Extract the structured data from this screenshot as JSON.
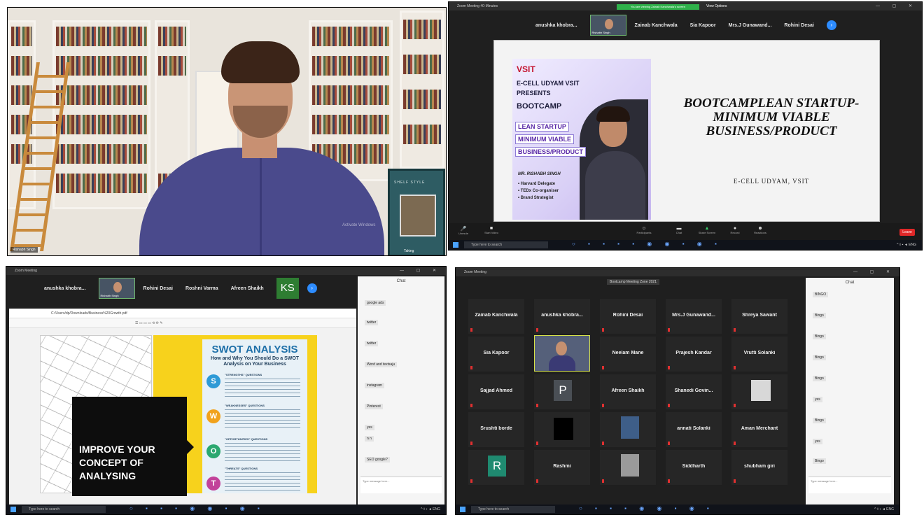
{
  "panel1": {
    "name_tag": "Rishabh Singh",
    "watermark": "Activate Windows",
    "poster_title": "SHELF STYLE",
    "poster_footer": "Taking"
  },
  "panel2": {
    "title": "Zoom Meeting 40-Minutes",
    "banner": "You are viewing Zainab Kanchwala's screen",
    "view_options": "View Options",
    "participants": [
      "anushka khobra...",
      "Zainab Kanchwala",
      "Sia Kapoor",
      "Mrs.J Gunawand...",
      "Rohini Desai"
    ],
    "thumb_label": "Rishabh Singh",
    "slide": {
      "logo": "VSIT",
      "lines": [
        "E-CELL UDYAM VSIT",
        "PRESENTS",
        "BOOTCAMP"
      ],
      "highlights": [
        "LEAN STARTUP",
        "MINIMUM VIABLE",
        "BUSINESS/PRODUCT"
      ],
      "speaker": "MR. RISHABH SINGH",
      "bullets": [
        "• Harvard Delegate",
        "• TEDx Co-organiser",
        "• Brand Strategist"
      ],
      "title": "BOOTCAMPLEAN STARTUP- MINIMUM VIABLE BUSINESS/PRODUCT",
      "subtitle": "E-CELL UDYAM, VSIT"
    },
    "controls": [
      "Unmute",
      "Start Video",
      "Participants",
      "Chat",
      "Share Screen",
      "Record",
      "Reactions"
    ],
    "end_label": "Leave",
    "taskbar_search": "Type here to search"
  },
  "panel3": {
    "title": "Zoom Meeting",
    "participants": [
      "anushka khobra...",
      "Rohini Desai",
      "Roshni Varma",
      "Afreen Shaikh"
    ],
    "thumb_label": "Rishabh Singh",
    "ks_avatar": "KS",
    "url": "C:/Users/dp/Downloads/Business%20Growth.pdf",
    "slide_text": "IMPROVE YOUR CONCEPT OF ANALYSING",
    "swot_title": "SWOT ANALYSIS",
    "swot_subtitle": "How and Why You Should Do a SWOT Analysis on Your Business",
    "swot_letters": [
      "S",
      "W",
      "O",
      "T"
    ],
    "swot_heads": [
      "\"STRENGTHS\" QUESTIONS",
      "\"WEAKNESSES\" QUESTIONS",
      "\"OPPORTUNITIES\" QUESTIONS",
      "\"THREATS\" QUESTIONS"
    ],
    "chat_title": "Chat",
    "chat_msgs": [
      "google ads",
      "twitter",
      "twitter",
      "Word and textsaju",
      "instagram",
      "Pinterest",
      "yes",
      "n n",
      "SEO google?"
    ],
    "chat_placeholder": "Type message here...",
    "taskbar_search": "Type here to search"
  },
  "panel4": {
    "title": "Zoom Meeting",
    "meeting_label": "Bootcamp Meeting Zone 2021",
    "tiles": [
      "Zainab Kanchwala",
      "anushka khobra...",
      "Rohini Desai",
      "Mrs.J Gunawand...",
      "Shreya Sawant",
      "Sia Kapoor",
      "",
      "Neelam Mane",
      "Prajesh Kandar",
      "Vrutti Solanki",
      "Sajjad Ahmed",
      "",
      "Afreen Shaikh",
      "Shanedi Govin...",
      "",
      "Srushti borde",
      "",
      "",
      "annati Solanki",
      "Aman Merchant",
      "",
      "Rashmi",
      "",
      "Siddharth",
      "shubham giri"
    ],
    "avatars": {
      "p": "P",
      "r": "R"
    },
    "chat_title": "Chat",
    "chat_msgs": [
      "BINGO",
      "Bingo",
      "Bingo",
      "Bingo",
      "Bingo",
      "yes",
      "Bingo",
      "yes",
      "Bingo"
    ],
    "chat_placeholder": "Type message here...",
    "taskbar_search": "Type here to search"
  }
}
